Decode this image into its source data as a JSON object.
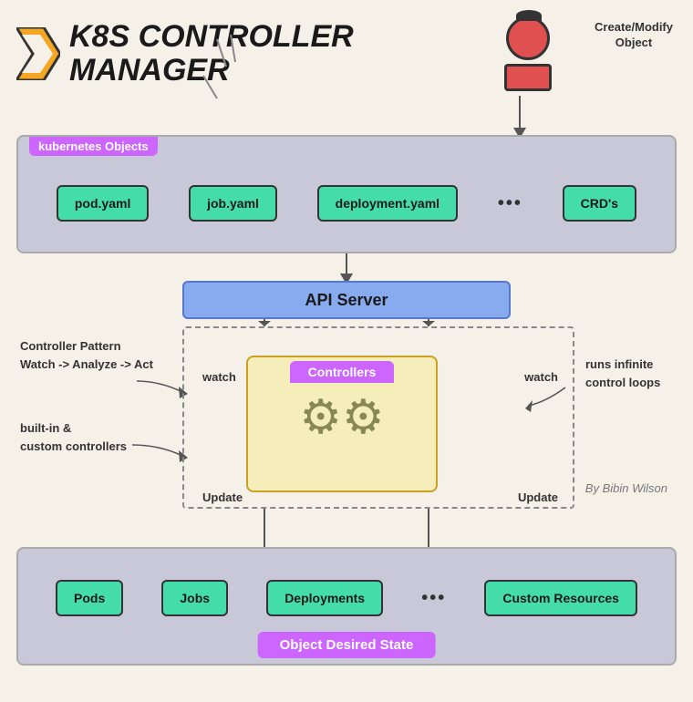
{
  "title": {
    "main": "K8S CONTROLLER",
    "sub": "MANAGER"
  },
  "user": {
    "action": "Create/Modify\nObject"
  },
  "k8s_objects": {
    "label": "kubernetes Objects",
    "items": [
      "pod.yaml",
      "job.yaml",
      "deployment.yaml",
      "CRD's"
    ],
    "dots": "•••"
  },
  "api_server": {
    "label": "API Server"
  },
  "controllers": {
    "label": "Controllers"
  },
  "annotations": {
    "top_left_line1": "Controller Pattern",
    "top_left_line2": "Watch -> Analyze -> Act",
    "bottom_left_line1": "built-in &",
    "bottom_left_line2": "custom controllers",
    "right_line1": "runs infinite",
    "right_line2": "control loops",
    "watch_left": "watch",
    "watch_right": "watch",
    "update_left": "Update",
    "update_right": "Update"
  },
  "resources": {
    "items": [
      "Pods",
      "Jobs",
      "Deployments",
      "Custom Resources"
    ],
    "dots": "•••",
    "desired_state_label": "Object Desired State"
  },
  "author": "By Bibin Wilson"
}
